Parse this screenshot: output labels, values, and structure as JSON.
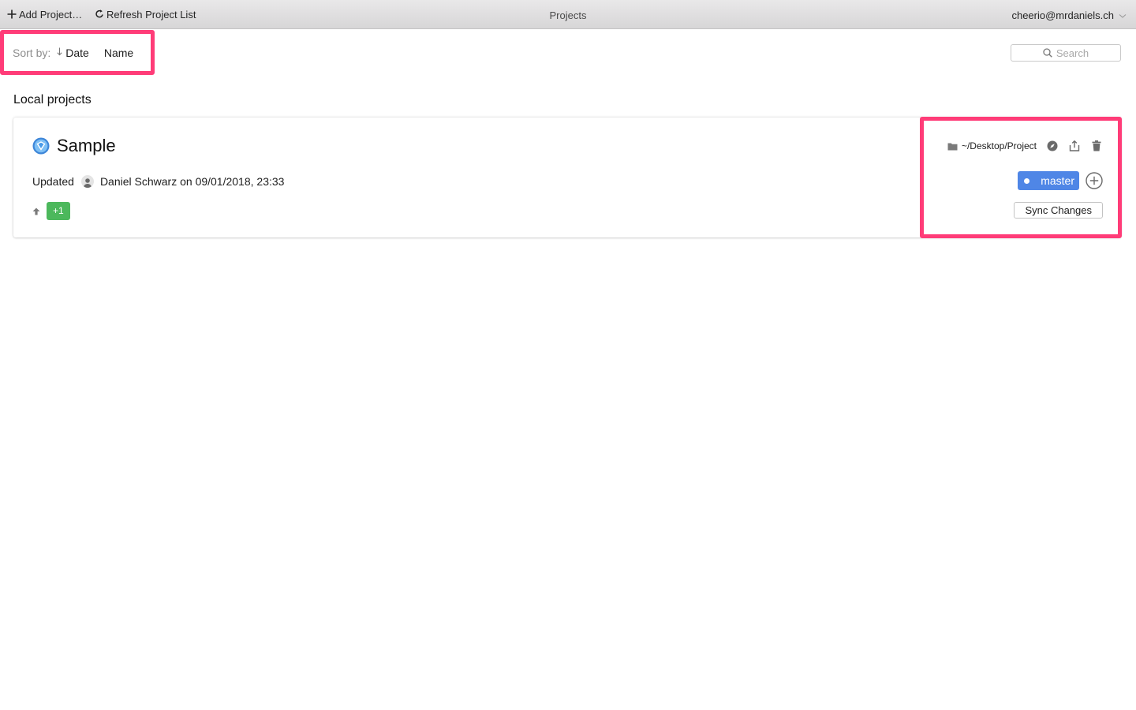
{
  "toolbar": {
    "add_project_label": "Add Project…",
    "refresh_label": "Refresh Project List",
    "title": "Projects",
    "user": "cheerio@mrdaniels.ch"
  },
  "sort": {
    "label": "Sort by:",
    "date": "Date",
    "name": "Name",
    "active": "Date"
  },
  "search": {
    "placeholder": "Search"
  },
  "section_title": "Local projects",
  "project": {
    "name": "Sample",
    "updated_prefix": "Updated",
    "author": "Daniel Schwarz",
    "on": "on",
    "date": "09/01/2018, 23:33",
    "ahead_count": "+1",
    "path": "~/Desktop/Project",
    "branch": "master",
    "sync_label": "Sync Changes"
  },
  "colors": {
    "highlight": "#ff3c78",
    "branch": "#4f86e6",
    "badge": "#4cb85c"
  },
  "icons": [
    "plus-icon",
    "refresh-icon",
    "chevron-down-icon",
    "sort-arrow-icon",
    "search-icon",
    "project-icon",
    "avatar-icon",
    "up-arrow-icon",
    "folder-icon",
    "compass-icon",
    "share-icon",
    "trash-icon",
    "add-branch-icon"
  ]
}
